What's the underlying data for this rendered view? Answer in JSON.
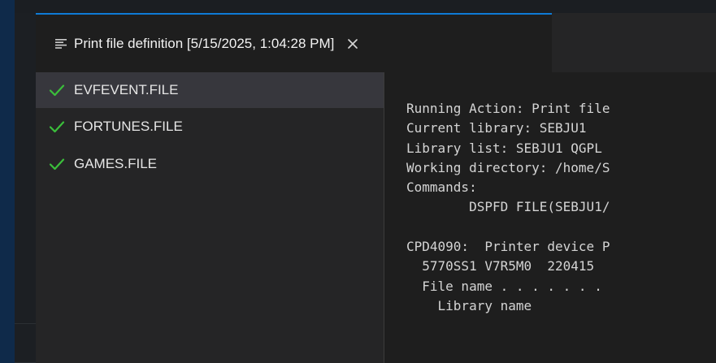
{
  "tab": {
    "icon": "lines-icon",
    "title": "Print file definition [5/15/2025, 1:04:28 PM]",
    "close_icon": "close-icon"
  },
  "colors": {
    "accent": "#0e7bd6",
    "check": "#3bbf3b",
    "selected_bg": "#37373d"
  },
  "files": [
    {
      "label": "EVFEVENT.FILE",
      "status": "success",
      "icon": "check-icon",
      "selected": true
    },
    {
      "label": "FORTUNES.FILE",
      "status": "success",
      "icon": "check-icon",
      "selected": false
    },
    {
      "label": "GAMES.FILE",
      "status": "success",
      "icon": "check-icon",
      "selected": false
    }
  ],
  "output": {
    "lines": [
      "Running Action: Print file",
      "Current library: SEBJU1",
      "Library list: SEBJU1 QGPL",
      "Working directory: /home/S",
      "Commands:",
      "        DSPFD FILE(SEBJU1/",
      "",
      "CPD4090:  Printer device P",
      "  5770SS1 V7R5M0  220415",
      "  File name . . . . . . .",
      "    Library name"
    ]
  }
}
